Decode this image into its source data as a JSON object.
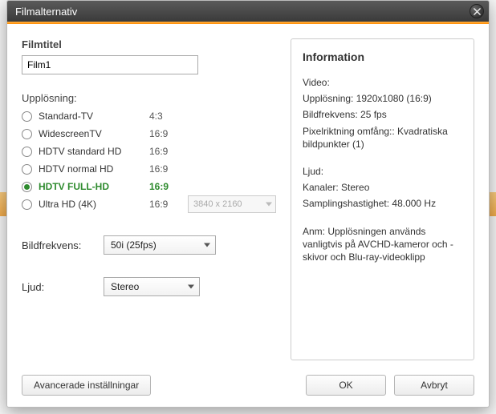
{
  "window": {
    "title": "Filmalternativ"
  },
  "form": {
    "title_label": "Filmtitel",
    "title_value": "Film1",
    "resolution_label": "Upplösning:",
    "resolutions": [
      {
        "label": "Standard-TV",
        "aspect": "4:3",
        "selected": false
      },
      {
        "label": "WidescreenTV",
        "aspect": "16:9",
        "selected": false
      },
      {
        "label": "HDTV standard HD",
        "aspect": "16:9",
        "selected": false
      },
      {
        "label": "HDTV normal HD",
        "aspect": "16:9",
        "selected": false
      },
      {
        "label": "HDTV FULL-HD",
        "aspect": "16:9",
        "selected": true
      },
      {
        "label": "Ultra HD (4K)",
        "aspect": "16:9",
        "selected": false
      }
    ],
    "uhd_res_placeholder": "3840 x 2160",
    "framerate_label": "Bildfrekvens:",
    "framerate_value": "50i (25fps)",
    "audio_label": "Ljud:",
    "audio_value": "Stereo"
  },
  "info": {
    "heading": "Information",
    "video_heading": "Video:",
    "video_res": "Upplösning: 1920x1080 (16:9)",
    "video_fps": "Bildfrekvens: 25 fps",
    "video_par": "Pixelriktning omfång:: Kvadratiska bildpunkter (1)",
    "audio_heading": "Ljud:",
    "audio_channels": "Kanaler: Stereo",
    "audio_rate": "Samplingshastighet: 48.000 Hz",
    "note": "Anm: Upplösningen används vanligtvis på AVCHD-kameror och -skivor och Blu-ray-videoklipp"
  },
  "buttons": {
    "advanced": "Avancerade inställningar",
    "ok": "OK",
    "cancel": "Avbryt"
  }
}
